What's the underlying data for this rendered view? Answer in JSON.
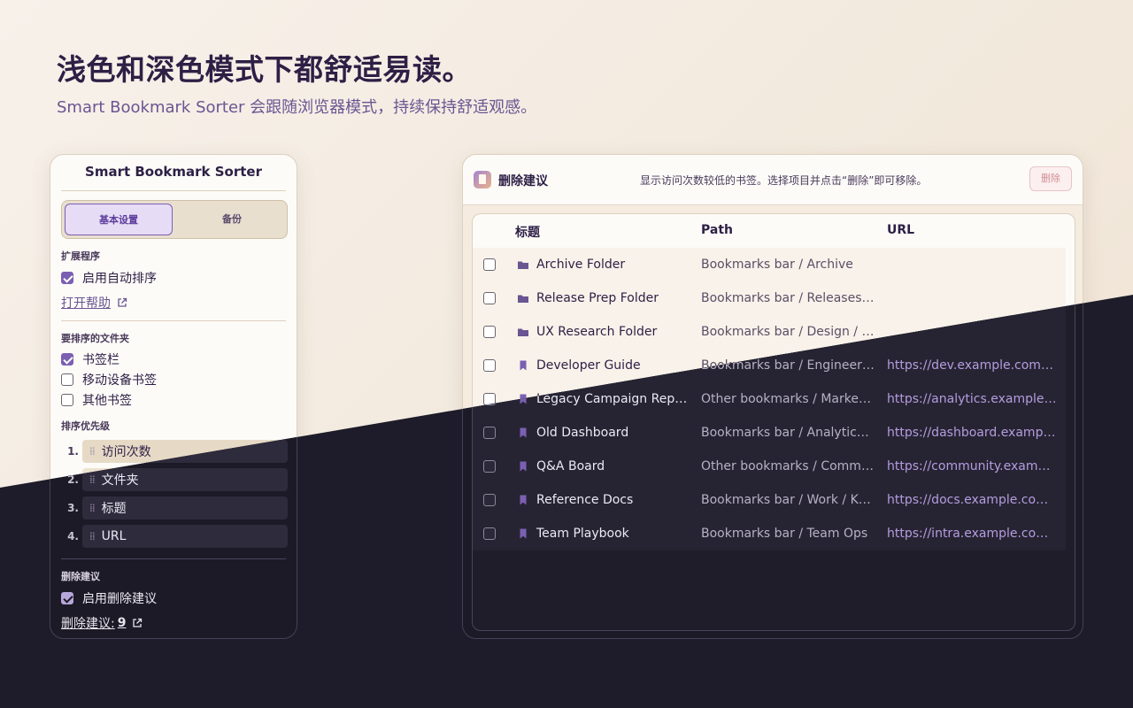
{
  "hero": {
    "title": "浅色和深色模式下都舒适易读。",
    "subtitle": "Smart Bookmark Sorter 会跟随浏览器模式，持续保持舒适观感。"
  },
  "settings_card": {
    "title": "Smart Bookmark Sorter",
    "tabs": [
      {
        "label": "基本设置",
        "active": true
      },
      {
        "label": "备份",
        "active": false
      }
    ],
    "extension_section": {
      "heading": "扩展程序",
      "auto_sort_label": "启用自动排序",
      "auto_sort_checked": true,
      "help_link": "打开帮助"
    },
    "folders_section": {
      "heading": "要排序的文件夹",
      "folders": [
        {
          "label": "书签栏",
          "checked": true
        },
        {
          "label": "移动设备书签",
          "checked": false
        },
        {
          "label": "其他书签",
          "checked": false
        }
      ]
    },
    "priority_section": {
      "heading": "排序优先级",
      "items": [
        {
          "index": "1.",
          "label": "访问次数"
        },
        {
          "index": "2.",
          "label": "文件夹"
        },
        {
          "index": "3.",
          "label": "标题"
        },
        {
          "index": "4.",
          "label": "URL"
        }
      ]
    },
    "delete_section": {
      "heading": "删除建议",
      "enable_label": "启用删除建议",
      "enable_checked": true,
      "link_label": "删除建议:",
      "link_count": "9"
    }
  },
  "delete_panel": {
    "title": "删除建议",
    "description": "显示访问次数较低的书签。选择项目并点击“删除”即可移除。",
    "delete_button": "删除",
    "columns": {
      "title": "标题",
      "path": "Path",
      "url": "URL"
    },
    "rows": [
      {
        "type": "folder",
        "title": "Archive Folder",
        "path": "Bookmarks bar / Archive",
        "url": ""
      },
      {
        "type": "folder",
        "title": "Release Prep Folder",
        "path": "Bookmarks bar / Releases / …",
        "url": ""
      },
      {
        "type": "folder",
        "title": "UX Research Folder",
        "path": "Bookmarks bar / Design / R…",
        "url": ""
      },
      {
        "type": "bookmark",
        "title": "Developer Guide",
        "path": "Bookmarks bar / Engineeri…",
        "url": "https://dev.example.com/g…"
      },
      {
        "type": "bookmark",
        "title": "Legacy Campaign Report",
        "path": "Other bookmarks / Marketi…",
        "url": "https://analytics.example.c…"
      },
      {
        "type": "bookmark",
        "title": "Old Dashboard",
        "path": "Bookmarks bar / Analytics /…",
        "url": "https://dashboard.example…"
      },
      {
        "type": "bookmark",
        "title": "Q&A Board",
        "path": "Other bookmarks / Commu…",
        "url": "https://community.exampl…"
      },
      {
        "type": "bookmark",
        "title": "Reference Docs",
        "path": "Bookmarks bar / Work / Kn…",
        "url": "https://docs.example.com/…"
      },
      {
        "type": "bookmark",
        "title": "Team Playbook",
        "path": "Bookmarks bar / Team Ops",
        "url": "https://intra.example.com/…"
      }
    ]
  },
  "theme": {
    "accent": "#7b5fb2",
    "light_bg": "#f7f1ea",
    "dark_bg": "#1e1c2a"
  }
}
